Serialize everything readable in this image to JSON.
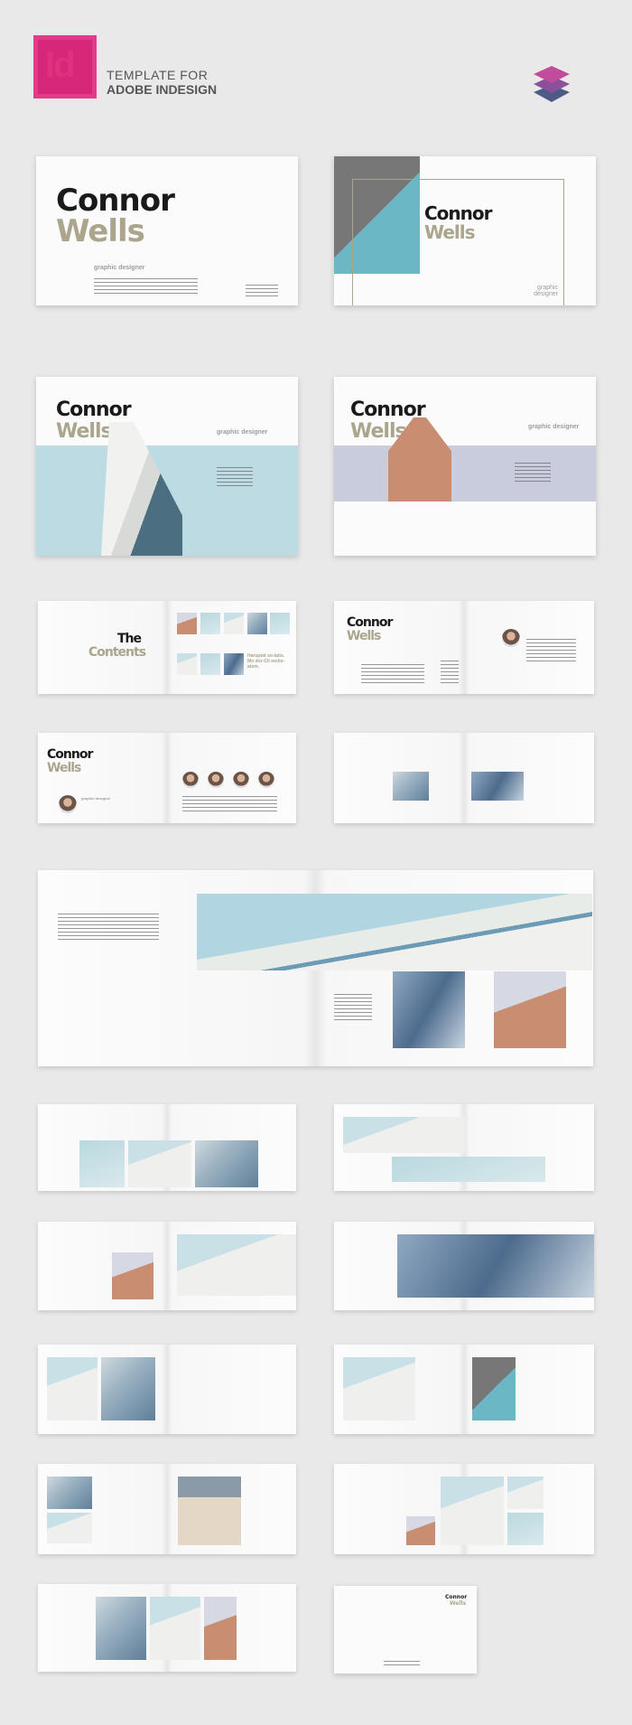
{
  "header": {
    "app_icon": "indesign-logo",
    "app_icon_text": "Id",
    "line1": "TEMPLATE FOR",
    "line2": "ADOBE INDESIGN",
    "layers_icon": "layers-icon",
    "brand_colors": {
      "pink": "#d6277b",
      "purple": "#8c4f9c",
      "navy": "#4d5a86"
    }
  },
  "brochure": {
    "first_name": "Connor",
    "last_name": "Wells",
    "role": "graphic designer",
    "contents_title_1": "The",
    "contents_title_2": "Contents",
    "contents_quote": "Haruptat so-tatis. Mo dor-Cil molor-atem.",
    "colors": {
      "dark": "#1a1a1a",
      "tan": "#aaa58c",
      "teal": "#6bb7c6",
      "pale_blue": "#bcdbe2",
      "lilac": "#c9ccdc"
    }
  }
}
